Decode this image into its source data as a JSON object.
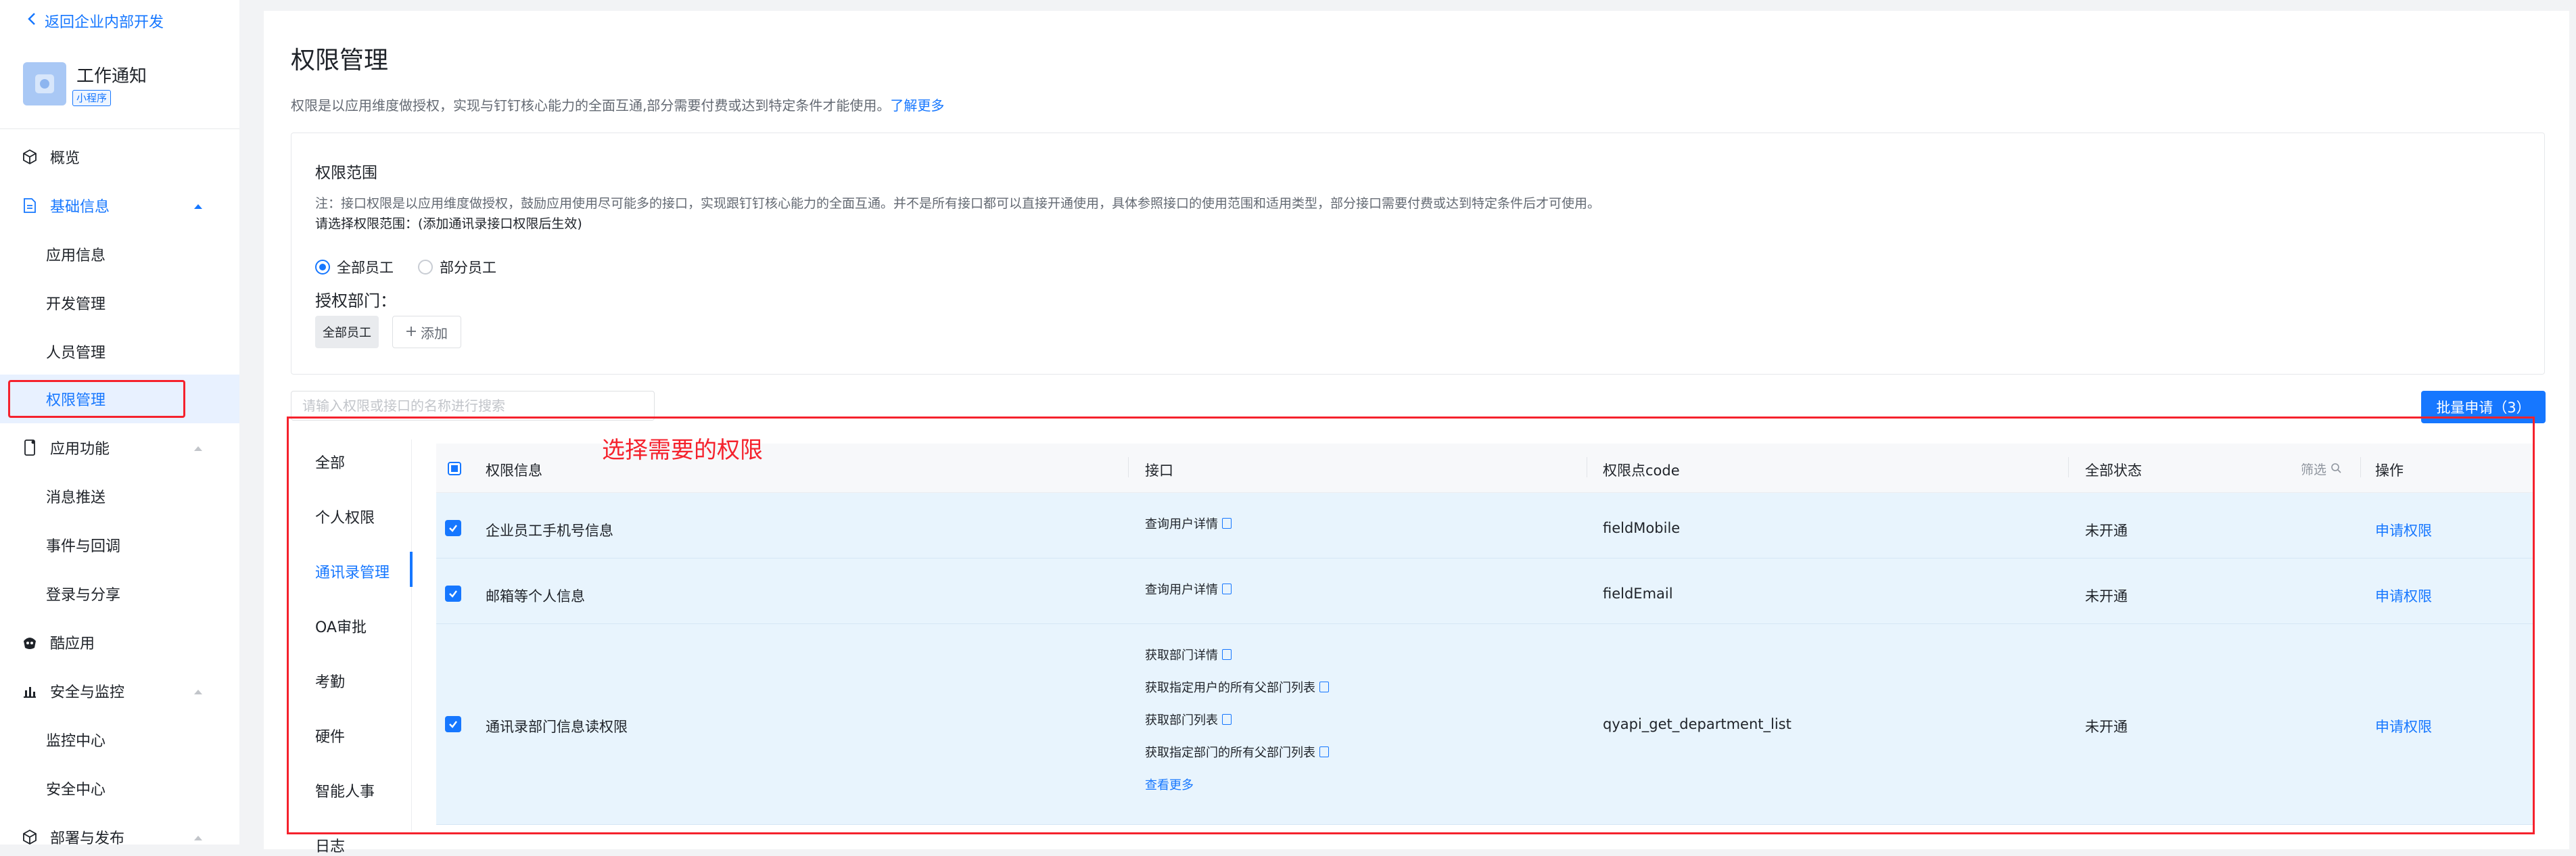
{
  "sidebar": {
    "back_label": "返回企业内部开发",
    "app_name": "工作通知",
    "app_tag": "小程序",
    "items": [
      {
        "label": "概览"
      },
      {
        "label": "基础信息"
      },
      {
        "label": "应用信息"
      },
      {
        "label": "开发管理"
      },
      {
        "label": "人员管理"
      },
      {
        "label": "权限管理"
      },
      {
        "label": "应用功能"
      },
      {
        "label": "消息推送"
      },
      {
        "label": "事件与回调"
      },
      {
        "label": "登录与分享"
      },
      {
        "label": "酷应用"
      },
      {
        "label": "安全与监控"
      },
      {
        "label": "监控中心"
      },
      {
        "label": "安全中心"
      },
      {
        "label": "部署与发布"
      }
    ]
  },
  "page": {
    "title": "权限管理",
    "desc": "权限是以应用维度做授权，实现与钉钉核心能力的全面互通,部分需要付费或达到特定条件才能使用。",
    "learn_more": "了解更多"
  },
  "scope": {
    "title": "权限范围",
    "note": "注：接口权限是以应用维度做授权，鼓励应用使用尽可能多的接口，实现跟钉钉核心能力的全面互通。并不是所有接口都可以直接开通使用，具体参照接口的使用范围和适用类型，部分接口需要付费或达到特定条件后才可使用。",
    "prompt": "请选择权限范围：(添加通讯录接口权限后生效)",
    "radio_all": "全部员工",
    "radio_part": "部分员工",
    "selected": "全部员工",
    "dept_label": "授权部门：",
    "dept_chip": "全部员工",
    "add_label": "添加"
  },
  "search": {
    "placeholder": "请输入权限或接口的名称进行搜索"
  },
  "batch_button": "批量申请（3）",
  "annotation": "选择需要的权限",
  "categories": [
    "全部",
    "个人权限",
    "通讯录管理",
    "OA审批",
    "考勤",
    "硬件",
    "智能人事",
    "日志"
  ],
  "active_category": "通讯录管理",
  "table": {
    "headers": {
      "info": "权限信息",
      "api": "接口",
      "code": "权限点code",
      "status": "全部状态",
      "filter": "筛选",
      "action": "操作"
    },
    "rows": [
      {
        "name": "企业员工手机号信息",
        "apis": [
          "查询用户详情"
        ],
        "code": "fieldMobile",
        "status": "未开通",
        "action": "申请权限",
        "checked": true
      },
      {
        "name": "邮箱等个人信息",
        "apis": [
          "查询用户详情"
        ],
        "code": "fieldEmail",
        "status": "未开通",
        "action": "申请权限",
        "checked": true
      },
      {
        "name": "通讯录部门信息读权限",
        "apis": [
          "获取部门详情",
          "获取指定用户的所有父部门列表",
          "获取部门列表",
          "获取指定部门的所有父部门列表"
        ],
        "more": "查看更多",
        "code": "qyapi_get_department_list",
        "status": "未开通",
        "action": "申请权限",
        "checked": true
      }
    ]
  },
  "colors": {
    "accent": "#1677ff",
    "annotation": "#f5222d",
    "row_selected": "#e8f4fd"
  }
}
